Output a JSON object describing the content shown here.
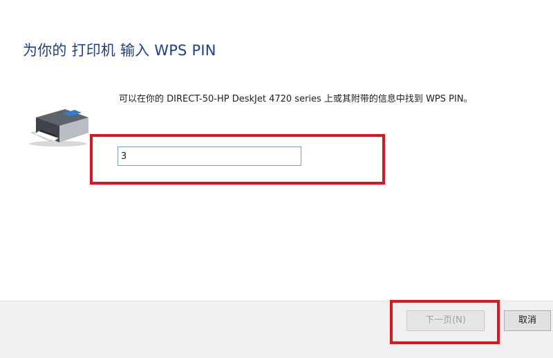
{
  "dialog": {
    "title": "为你的 打印机 输入 WPS PIN",
    "description": "可以在你的 DIRECT-50-HP DeskJet 4720 series 上或其附带的信息中找到 WPS PIN。",
    "pin_input": {
      "value": "3"
    },
    "buttons": {
      "next_label": "下一页(N)",
      "cancel_label": "取消"
    },
    "printer_icon": "printer-icon"
  },
  "colors": {
    "title": "#1f3f8f",
    "highlight": "#e0141e",
    "footer_bg": "#f0f0f0"
  }
}
